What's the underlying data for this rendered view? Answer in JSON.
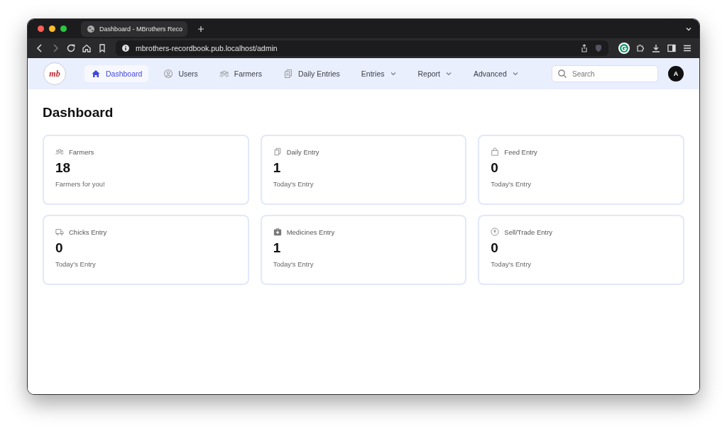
{
  "browser": {
    "tab_title": "Dashboard - MBrothers Reco",
    "url": "mbrothers-recordbook.pub.localhost/admin"
  },
  "logo": {
    "text": "mb"
  },
  "nav": [
    {
      "label": "Dashboard",
      "kind": "home",
      "selected": true
    },
    {
      "label": "Users",
      "kind": "user",
      "selected": false
    },
    {
      "label": "Farmers",
      "kind": "group",
      "selected": false
    },
    {
      "label": "Daily Entries",
      "kind": "copy",
      "selected": false
    },
    {
      "label": "Entries",
      "kind": "dropdown",
      "selected": false
    },
    {
      "label": "Report",
      "kind": "dropdown",
      "selected": false
    },
    {
      "label": "Advanced",
      "kind": "dropdown",
      "selected": false
    }
  ],
  "search": {
    "placeholder": "Search"
  },
  "avatar": "A",
  "page_title": "Dashboard",
  "cards": [
    {
      "title": "Farmers",
      "kind": "group",
      "value": "18",
      "caption": "Farmers for you!"
    },
    {
      "title": "Daily Entry",
      "kind": "copy",
      "value": "1",
      "caption": "Today's Entry"
    },
    {
      "title": "Feed Entry",
      "kind": "bag",
      "value": "0",
      "caption": "Today's Entry"
    },
    {
      "title": "Chicks Entry",
      "kind": "truck",
      "value": "0",
      "caption": "Today's Entry"
    },
    {
      "title": "Medicines Entry",
      "kind": "medkit",
      "value": "1",
      "caption": "Today's Entry"
    },
    {
      "title": "Sell/Trade Entry",
      "kind": "coin",
      "value": "0",
      "caption": "Today's Entry"
    }
  ]
}
